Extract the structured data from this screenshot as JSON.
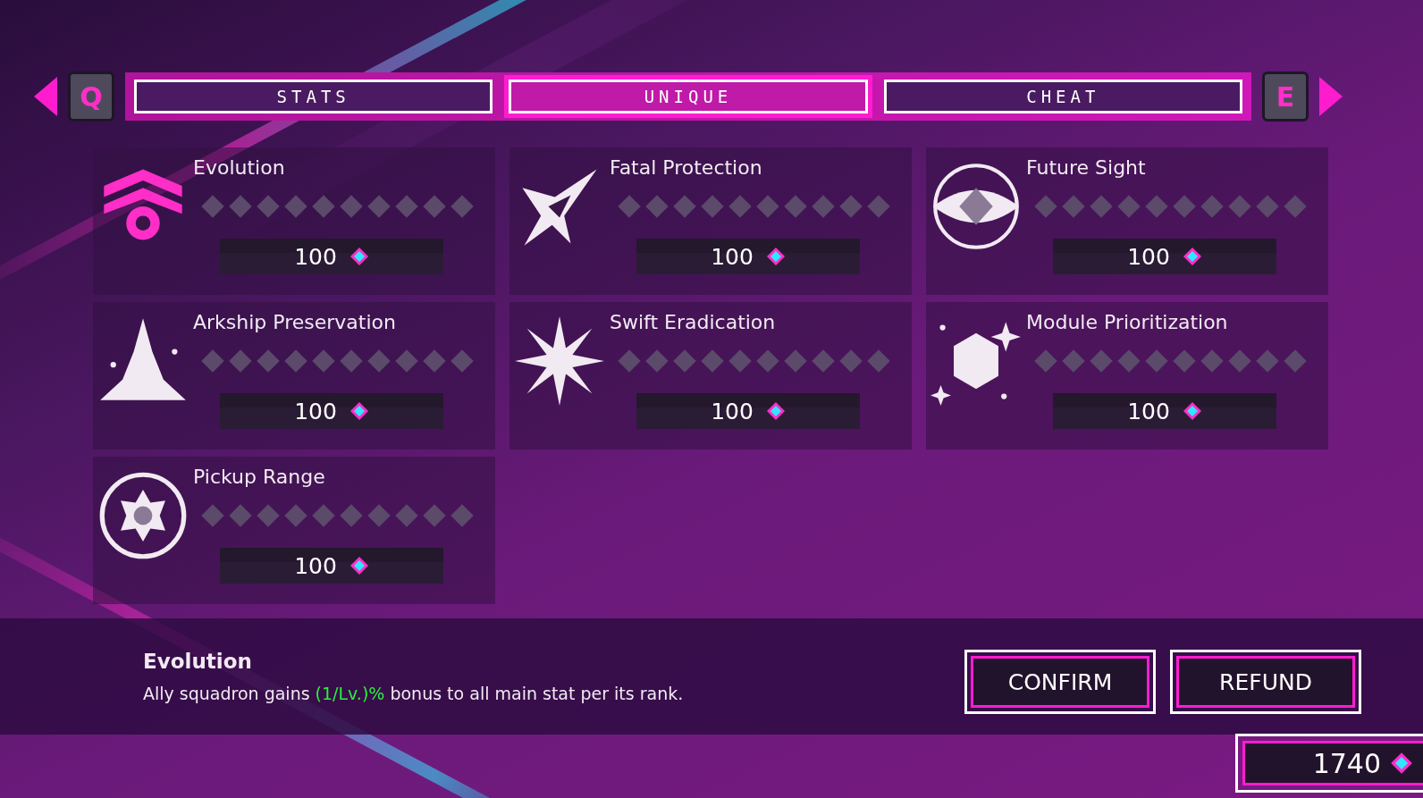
{
  "nav": {
    "prev_key": "Q",
    "next_key": "E"
  },
  "tabs": [
    {
      "label": "STATS",
      "selected": false
    },
    {
      "label": "UNIQUE",
      "selected": true
    },
    {
      "label": "CHEAT",
      "selected": false
    }
  ],
  "skills": [
    {
      "name": "Evolution",
      "cost": "100",
      "selected": true
    },
    {
      "name": "Fatal Protection",
      "cost": "100",
      "selected": false
    },
    {
      "name": "Future Sight",
      "cost": "100",
      "selected": false
    },
    {
      "name": "Arkship Preservation",
      "cost": "100",
      "selected": false
    },
    {
      "name": "Swift Eradication",
      "cost": "100",
      "selected": false
    },
    {
      "name": "Module Prioritization",
      "cost": "100",
      "selected": false
    },
    {
      "name": "Pickup Range",
      "cost": "100",
      "selected": false
    }
  ],
  "detail": {
    "title": "Evolution",
    "description": "Ally squadron gains **(1/Lv.)%** bonus to all main stat per its rank."
  },
  "buttons": [
    "CONFIRM",
    "REFUND"
  ],
  "currency": "1740"
}
